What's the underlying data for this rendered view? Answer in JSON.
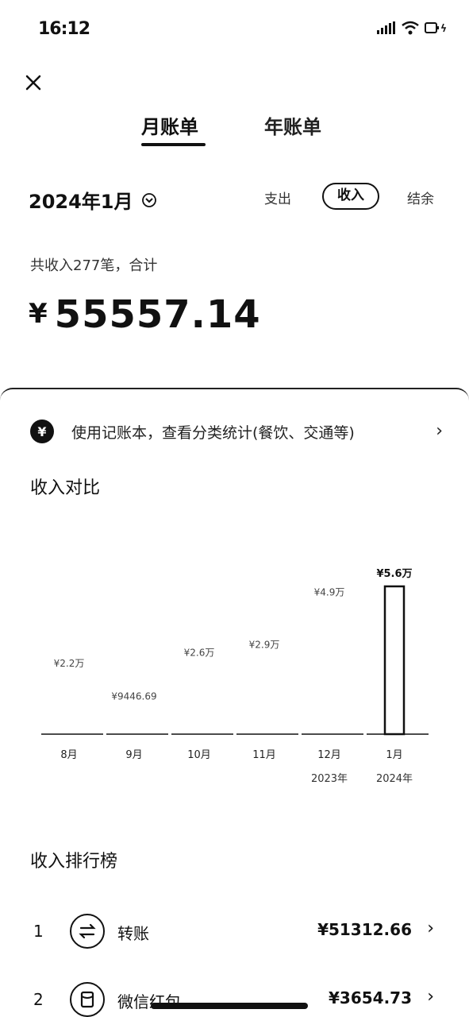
{
  "status_bar": {
    "time": "16:12"
  },
  "header": {
    "tabs": [
      {
        "label": "月账单",
        "active": true
      },
      {
        "label": "年账单",
        "active": false
      }
    ]
  },
  "filter": {
    "month": "2024年1月",
    "segments": [
      "支出",
      "收入",
      "结余"
    ],
    "active_segment": "收入"
  },
  "summary": {
    "line": "共收入277笔，合计",
    "total": "55557.14",
    "currency": "¥"
  },
  "promo": {
    "text": "使用记账本，查看分类统计(餐饮、交通等)"
  },
  "chart_section": {
    "title": "收入对比"
  },
  "chart_data": {
    "type": "bar",
    "categories": [
      "8月",
      "9月",
      "10月",
      "11月",
      "12月",
      "1月"
    ],
    "year_labels": [
      "2023年",
      "2024年"
    ],
    "values": [
      22000,
      9446.69,
      26000,
      29000,
      49000,
      56000
    ],
    "value_labels": [
      "¥2.2万",
      "¥9446.69",
      "¥2.6万",
      "¥2.9万",
      "¥4.9万",
      "¥5.6万"
    ],
    "highlight_index": 5,
    "ylim": [
      0,
      56000
    ]
  },
  "ranking": {
    "title": "收入排行榜",
    "items": [
      {
        "rank": "1",
        "name": "转账",
        "amount": "¥51312.66",
        "icon": "transfer-icon"
      },
      {
        "rank": "2",
        "name": "微信红包",
        "amount": "¥3654.73",
        "icon": "red-packet-icon"
      }
    ]
  },
  "colors": {
    "text": "#111111",
    "background": "#ffffff"
  }
}
